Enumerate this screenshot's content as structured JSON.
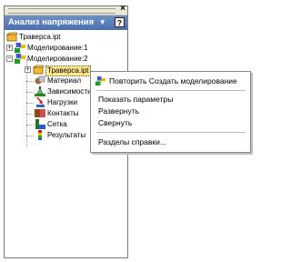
{
  "panel": {
    "close_label": "×",
    "title": "Анализ напряжения",
    "title_arrow": "▼",
    "help_label": "?"
  },
  "tree": {
    "root": "Траверса.ipt",
    "sim1": "Моделирование:1",
    "sim2": "Моделирование:2",
    "part": "Траверса.ipt",
    "material": "Материал",
    "constraints": "Зависимости",
    "loads": "Нагрузки",
    "contacts": "Контакты",
    "mesh": "Сетка",
    "results": "Результаты"
  },
  "context_menu": {
    "repeat": "Повторить Создать моделирование",
    "show_params": "Показать параметры",
    "expand": "Развернуть",
    "collapse": "Свернуть",
    "help_topics": "Разделы справки..."
  },
  "colors": {
    "header": "#4a6fb3",
    "selection": "#ffe98a"
  }
}
